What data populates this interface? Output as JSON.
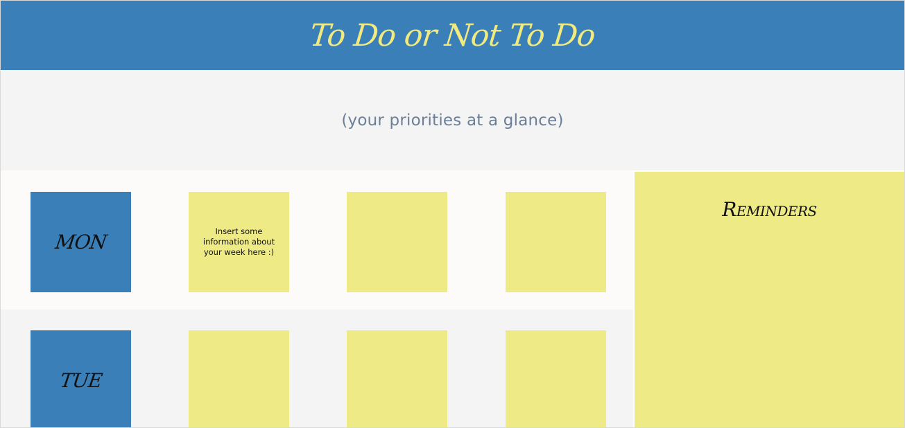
{
  "header": {
    "title": "To Do or Not To Do"
  },
  "subheader": {
    "tagline": "(your priorities at a glance)"
  },
  "days": [
    {
      "label": "MON",
      "notes": [
        "Insert some information about your week here :)",
        "",
        ""
      ]
    },
    {
      "label": "TUE",
      "notes": [
        "",
        "",
        ""
      ]
    }
  ],
  "reminders": {
    "title": "Reminders"
  },
  "colors": {
    "header_bg": "#3a7fb8",
    "title_text": "#f0ea7f",
    "sticky_note": "#eeea86",
    "day_box": "#3a7fb8",
    "subheader_bg": "#f4f4f4",
    "tagline_text": "#6c7f98"
  }
}
